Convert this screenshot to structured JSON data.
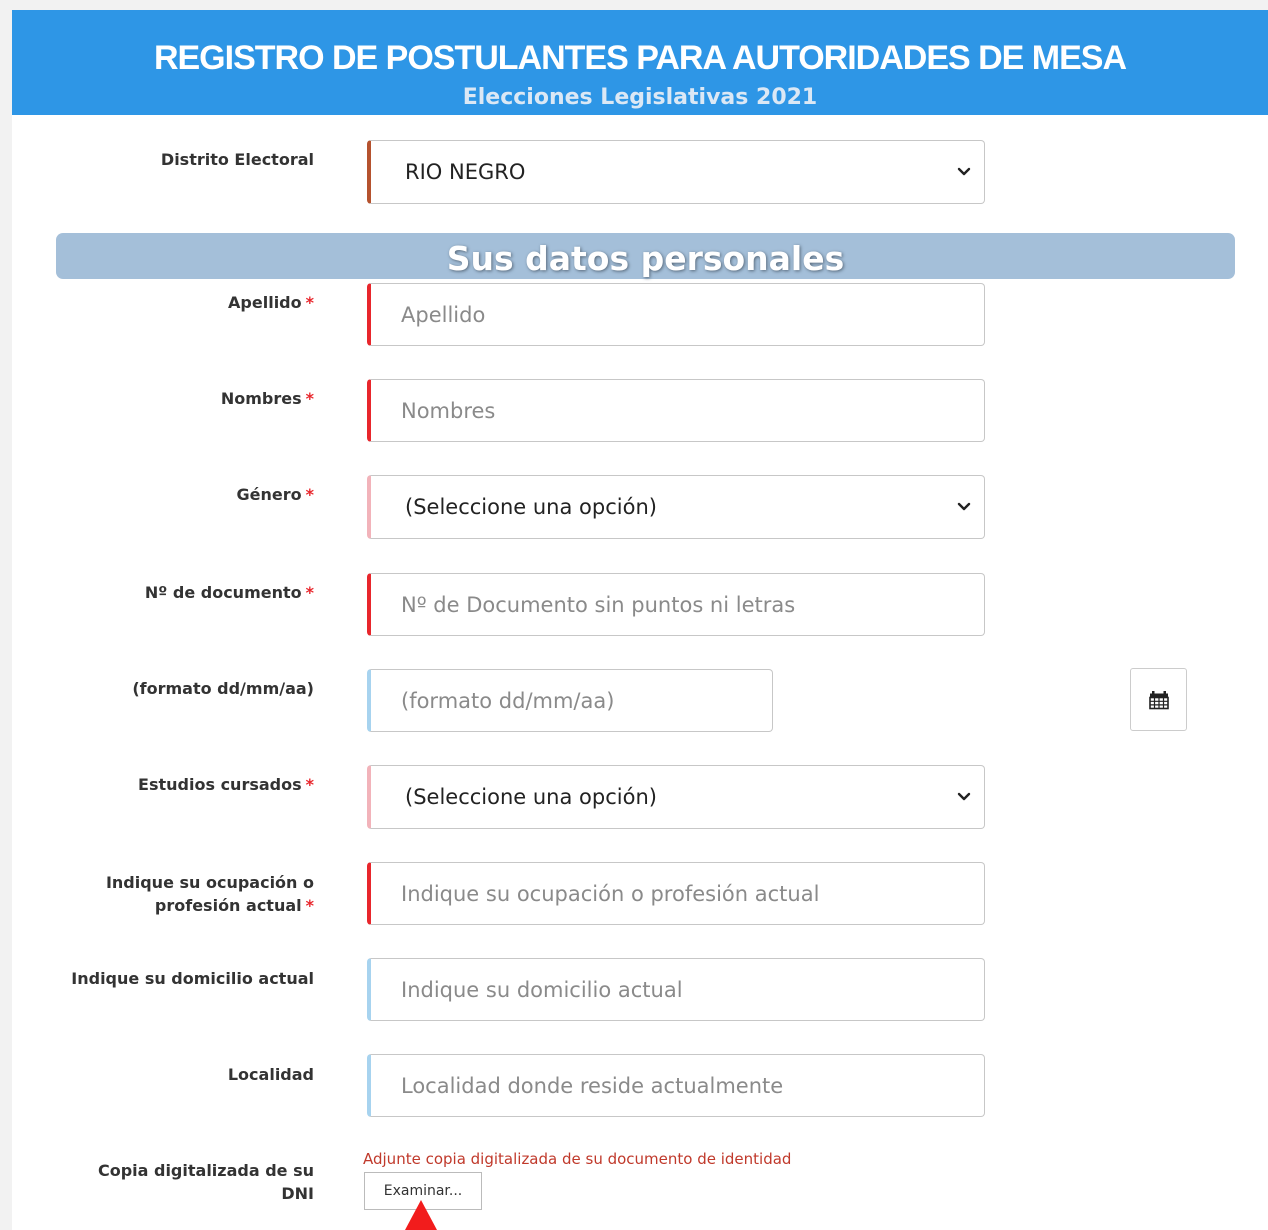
{
  "header": {
    "title": "REGISTRO DE POSTULANTES PARA AUTORIDADES DE MESA",
    "subtitle": "Elecciones Legislativas 2021"
  },
  "distrito": {
    "label": "Distrito Electoral",
    "value": "RIO NEGRO"
  },
  "section_title": "Sus datos personales",
  "required_marker": "*",
  "fields": {
    "apellido": {
      "label": "Apellido",
      "placeholder": "Apellido"
    },
    "nombres": {
      "label": "Nombres",
      "placeholder": "Nombres"
    },
    "genero": {
      "label": "Género",
      "value": "(Seleccione una opción)"
    },
    "documento": {
      "label": "Nº de documento",
      "placeholder": "Nº de Documento sin puntos ni letras"
    },
    "fecha": {
      "label": "(formato dd/mm/aa)",
      "placeholder": "(formato dd/mm/aa)"
    },
    "estudios": {
      "label": "Estudios cursados",
      "value": "(Seleccione una opción)"
    },
    "ocupacion": {
      "label_line1": "Indique su ocupación o",
      "label_line2": "profesión actual",
      "placeholder": "Indique su ocupación o profesión actual"
    },
    "domicilio": {
      "label": "Indique su domicilio actual",
      "placeholder": "Indique su domicilio actual"
    },
    "localidad": {
      "label": "Localidad",
      "placeholder": "Localidad donde reside actualmente"
    },
    "dni": {
      "label_line1": "Copia digitalizada de su",
      "label_line2": "DNI",
      "note": "Adjunte copia digitalizada de su documento de identidad",
      "button": "Examinar..."
    }
  },
  "icons": {
    "select": "chevron-down-icon",
    "calendar": "calendar-icon",
    "pointer": "mouse-pointer-icon"
  },
  "colors": {
    "header_bg": "#2e96e6",
    "section_bg": "#a4bfd9",
    "required": "#e8262c",
    "optional_border": "#a7d3ef",
    "note": "#c0392b"
  }
}
